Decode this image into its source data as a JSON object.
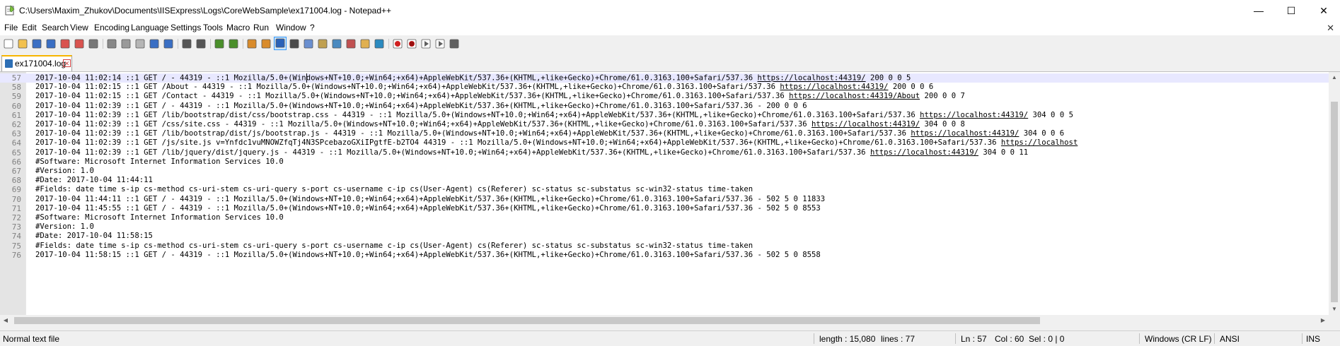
{
  "window": {
    "title": "C:\\Users\\Maxim_Zhukov\\Documents\\IISExpress\\Logs\\CoreWebSample\\ex171004.log - Notepad++",
    "minimize_glyph": "—",
    "maximize_glyph": "☐",
    "close_glyph": "✕"
  },
  "menu": {
    "items": [
      "File",
      "Edit",
      "Search",
      "View",
      "Encoding",
      "Language",
      "Settings",
      "Tools",
      "Macro",
      "Run",
      "Window",
      "?"
    ],
    "close_glyph": "✕"
  },
  "toolbar": {
    "icons": [
      "new-file-icon",
      "open-file-icon",
      "save-icon",
      "save-all-icon",
      "close-icon",
      "close-all-icon",
      "print-icon",
      "cut-icon",
      "copy-icon",
      "paste-icon",
      "undo-icon",
      "redo-icon",
      "find-icon",
      "replace-icon",
      "zoom-in-icon",
      "zoom-out-icon",
      "sync-vertical-icon",
      "sync-horizontal-icon",
      "word-wrap-icon",
      "show-all-characters-icon",
      "indent-guide-icon",
      "language-define-icon",
      "document-map-icon",
      "function-list-icon",
      "folder-as-workspace-icon",
      "monitoring-icon",
      "record-macro-icon",
      "stop-recording-icon",
      "play-macro-icon",
      "run-macro-multiple-icon",
      "save-macro-icon"
    ]
  },
  "tab": {
    "label": "ex171004.log"
  },
  "editor": {
    "current_line": 57,
    "lines": [
      {
        "n": "57",
        "parts": [
          {
            "t": "2017-10-04 11:02:14 ::1 GET / - 44319 - ::1 Mozilla/5.0+(Win"
          },
          {
            "caret": true
          },
          {
            "t": "dows+NT+10.0;+Win64;+x64)+AppleWebKit/537.36+(KHTML,+like+Gecko)+Chrome/61.0.3163.100+Safari/537.36 "
          },
          {
            "t": "https://localhost:44319/",
            "link": true
          },
          {
            "t": " 200 0 0 5"
          }
        ]
      },
      {
        "n": "58",
        "parts": [
          {
            "t": "2017-10-04 11:02:15 ::1 GET /About - 44319 - ::1 Mozilla/5.0+(Windows+NT+10.0;+Win64;+x64)+AppleWebKit/537.36+(KHTML,+like+Gecko)+Chrome/61.0.3163.100+Safari/537.36 "
          },
          {
            "t": "https://localhost:44319/",
            "link": true
          },
          {
            "t": " 200 0 0 6"
          }
        ]
      },
      {
        "n": "59",
        "parts": [
          {
            "t": "2017-10-04 11:02:15 ::1 GET /Contact - 44319 - ::1 Mozilla/5.0+(Windows+NT+10.0;+Win64;+x64)+AppleWebKit/537.36+(KHTML,+like+Gecko)+Chrome/61.0.3163.100+Safari/537.36 "
          },
          {
            "t": "https://localhost:44319/About",
            "link": true
          },
          {
            "t": " 200 0 0 7"
          }
        ]
      },
      {
        "n": "60",
        "parts": [
          {
            "t": "2017-10-04 11:02:39 ::1 GET / - 44319 - ::1 Mozilla/5.0+(Windows+NT+10.0;+Win64;+x64)+AppleWebKit/537.36+(KHTML,+like+Gecko)+Chrome/61.0.3163.100+Safari/537.36 - 200 0 0 6"
          }
        ]
      },
      {
        "n": "61",
        "parts": [
          {
            "t": "2017-10-04 11:02:39 ::1 GET /lib/bootstrap/dist/css/bootstrap.css - 44319 - ::1 Mozilla/5.0+(Windows+NT+10.0;+Win64;+x64)+AppleWebKit/537.36+(KHTML,+like+Gecko)+Chrome/61.0.3163.100+Safari/537.36 "
          },
          {
            "t": "https://localhost:44319/",
            "link": true
          },
          {
            "t": " 304 0 0 5"
          }
        ]
      },
      {
        "n": "62",
        "parts": [
          {
            "t": "2017-10-04 11:02:39 ::1 GET /css/site.css - 44319 - ::1 Mozilla/5.0+(Windows+NT+10.0;+Win64;+x64)+AppleWebKit/537.36+(KHTML,+like+Gecko)+Chrome/61.0.3163.100+Safari/537.36 "
          },
          {
            "t": "https://localhost:44319/",
            "link": true
          },
          {
            "t": " 304 0 0 8"
          }
        ]
      },
      {
        "n": "63",
        "parts": [
          {
            "t": "2017-10-04 11:02:39 ::1 GET /lib/bootstrap/dist/js/bootstrap.js - 44319 - ::1 Mozilla/5.0+(Windows+NT+10.0;+Win64;+x64)+AppleWebKit/537.36+(KHTML,+like+Gecko)+Chrome/61.0.3163.100+Safari/537.36 "
          },
          {
            "t": "https://localhost:44319/",
            "link": true
          },
          {
            "t": " 304 0 0 6"
          }
        ]
      },
      {
        "n": "64",
        "parts": [
          {
            "t": "2017-10-04 11:02:39 ::1 GET /js/site.js v=Ynfdc1vuMNOWZfqTj4N3SPcebazoGXiIPgtfE-b2TO4 44319 - ::1 Mozilla/5.0+(Windows+NT+10.0;+Win64;+x64)+AppleWebKit/537.36+(KHTML,+like+Gecko)+Chrome/61.0.3163.100+Safari/537.36 "
          },
          {
            "t": "https://localhost",
            "link": true
          }
        ]
      },
      {
        "n": "65",
        "parts": [
          {
            "t": "2017-10-04 11:02:39 ::1 GET /lib/jquery/dist/jquery.js - 44319 - ::1 Mozilla/5.0+(Windows+NT+10.0;+Win64;+x64)+AppleWebKit/537.36+(KHTML,+like+Gecko)+Chrome/61.0.3163.100+Safari/537.36 "
          },
          {
            "t": "https://localhost:44319/",
            "link": true
          },
          {
            "t": " 304 0 0 11"
          }
        ]
      },
      {
        "n": "66",
        "parts": [
          {
            "t": "#Software: Microsoft Internet Information Services 10.0"
          }
        ]
      },
      {
        "n": "67",
        "parts": [
          {
            "t": "#Version: 1.0"
          }
        ]
      },
      {
        "n": "68",
        "parts": [
          {
            "t": "#Date: 2017-10-04 11:44:11"
          }
        ]
      },
      {
        "n": "69",
        "parts": [
          {
            "t": "#Fields: date time s-ip cs-method cs-uri-stem cs-uri-query s-port cs-username c-ip cs(User-Agent) cs(Referer) sc-status sc-substatus sc-win32-status time-taken"
          }
        ]
      },
      {
        "n": "70",
        "parts": [
          {
            "t": "2017-10-04 11:44:11 ::1 GET / - 44319 - ::1 Mozilla/5.0+(Windows+NT+10.0;+Win64;+x64)+AppleWebKit/537.36+(KHTML,+like+Gecko)+Chrome/61.0.3163.100+Safari/537.36 - 502 5 0 11833"
          }
        ]
      },
      {
        "n": "71",
        "parts": [
          {
            "t": "2017-10-04 11:45:55 ::1 GET / - 44319 - ::1 Mozilla/5.0+(Windows+NT+10.0;+Win64;+x64)+AppleWebKit/537.36+(KHTML,+like+Gecko)+Chrome/61.0.3163.100+Safari/537.36 - 502 5 0 8553"
          }
        ]
      },
      {
        "n": "72",
        "parts": [
          {
            "t": "#Software: Microsoft Internet Information Services 10.0"
          }
        ]
      },
      {
        "n": "73",
        "parts": [
          {
            "t": "#Version: 1.0"
          }
        ]
      },
      {
        "n": "74",
        "parts": [
          {
            "t": "#Date: 2017-10-04 11:58:15"
          }
        ]
      },
      {
        "n": "75",
        "parts": [
          {
            "t": "#Fields: date time s-ip cs-method cs-uri-stem cs-uri-query s-port cs-username c-ip cs(User-Agent) cs(Referer) sc-status sc-substatus sc-win32-status time-taken"
          }
        ]
      },
      {
        "n": "76",
        "parts": [
          {
            "t": "2017-10-04 11:58:15 ::1 GET / - 44319 - ::1 Mozilla/5.0+(Windows+NT+10.0;+Win64;+x64)+AppleWebKit/537.36+(KHTML,+like+Gecko)+Chrome/61.0.3163.100+Safari/537.36 - 502 5 0 8558"
          }
        ]
      }
    ]
  },
  "status": {
    "file_type": "Normal text file",
    "length": "length : 15,080",
    "lines": "lines : 77",
    "ln": "Ln : 57",
    "col": "Col : 60",
    "sel": "Sel : 0 | 0",
    "eol": "Windows (CR LF)",
    "encoding": "ANSI",
    "mode": "INS"
  },
  "colors": {
    "current_line": "#e8e8ff",
    "gutter": "#e4e4e4",
    "tab_accent": "#f7b500"
  }
}
